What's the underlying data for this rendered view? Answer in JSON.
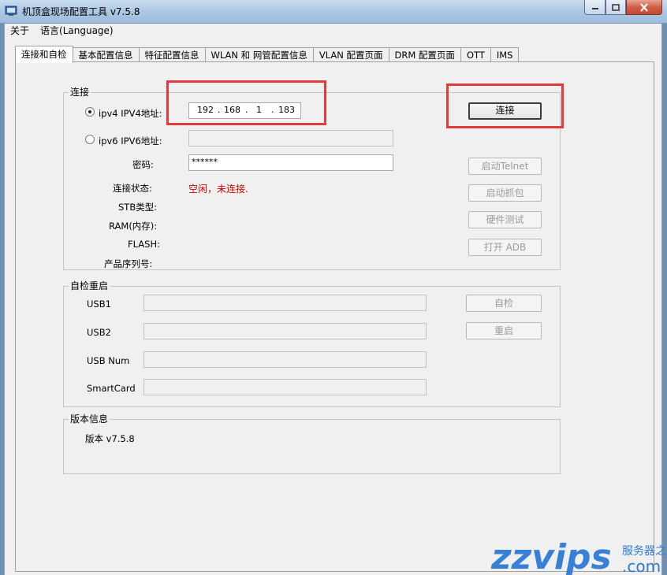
{
  "window": {
    "title": "机顶盒现场配置工具 v7.5.8"
  },
  "menu": {
    "items": [
      "关于",
      "语言(Language)"
    ]
  },
  "tabs": [
    "连接和自检",
    "基本配置信息",
    "特征配置信息",
    "WLAN 和 网管配置信息",
    "VLAN 配置页面",
    "DRM 配置页面",
    "OTT",
    "IMS"
  ],
  "connection": {
    "group_title": "连接",
    "ipv4_label": "ipv4 IPV4地址:",
    "ipv6_label": "ipv6 IPV6地址:",
    "ipv4_octets": [
      "192",
      "168",
      "1",
      "183"
    ],
    "ipv4_selected": true,
    "ipv6_value": "",
    "password_label": "密码:",
    "password_value": "******",
    "status_label": "连接状态:",
    "status_value": "空闲，未连接.",
    "status_color": "#d40000",
    "stb_type_label": "STB类型:",
    "ram_label": "RAM(内存):",
    "flash_label": "FLASH:",
    "serial_label": "产品序列号:",
    "connect_button": "连接",
    "telnet_button": "启动Telnet",
    "capture_button": "启动抓包",
    "hwtest_button": "硬件测试",
    "adb_button": "打开 ADB"
  },
  "selftest": {
    "group_title": "自检重启",
    "usb1_label": "USB1",
    "usb2_label": "USB2",
    "usbnum_label": "USB Num",
    "smartcard_label": "SmartCard",
    "check_button": "自检",
    "restart_button": "重启"
  },
  "version": {
    "group_title": "版本信息",
    "text": "版本 v7.5.8"
  },
  "watermark": {
    "brand": "zzvips",
    "suffix": ".com",
    "tagline": "服务器之家",
    "colors": {
      "red": "#e02020",
      "blue": "#2e7bd6"
    }
  }
}
